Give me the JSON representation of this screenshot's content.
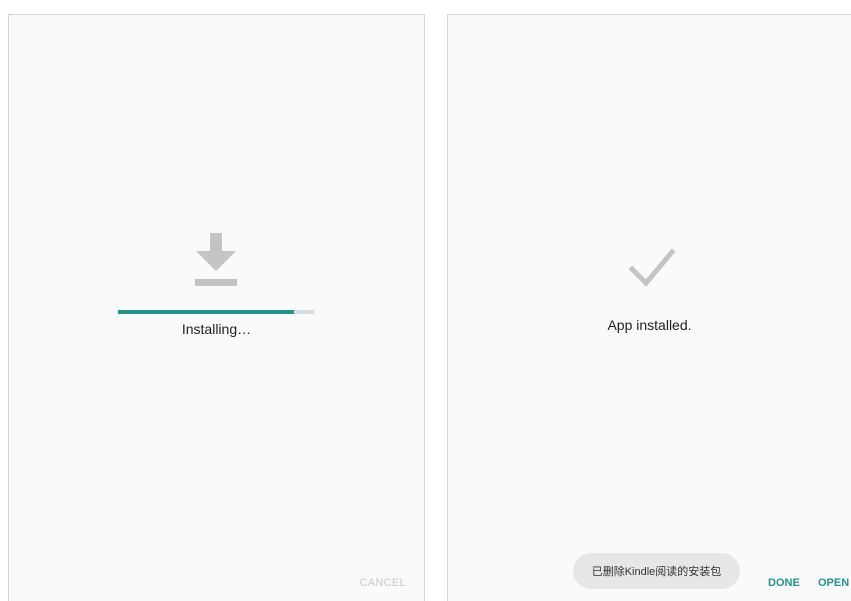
{
  "install_screen": {
    "status_text": "Installing…",
    "progress_fraction": 0.9,
    "cancel_label": "CANCEL",
    "icon": "download-icon"
  },
  "installed_screen": {
    "status_text": "App installed.",
    "toast_text": "已删除Kindle阅读的安装包",
    "done_label": "DONE",
    "open_label": "OPEN",
    "icon": "check-icon"
  },
  "colors": {
    "accent": "#1f968b",
    "progress_track": "#d9dcdc",
    "icon_gray": "#c4c4c4",
    "disabled_text": "#c9c9c9",
    "background": "#fafafa"
  }
}
